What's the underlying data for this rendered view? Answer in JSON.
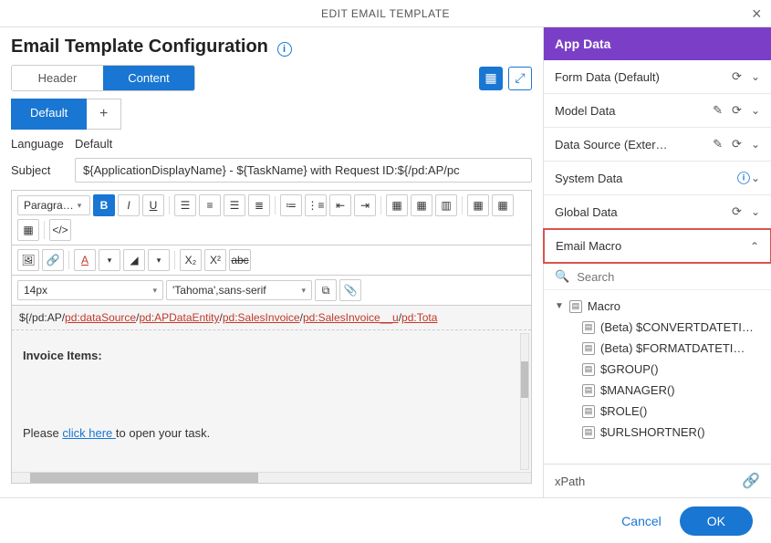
{
  "modal": {
    "title": "EDIT EMAIL TEMPLATE"
  },
  "config": {
    "title": "Email Template Configuration",
    "tabs": {
      "header": "Header",
      "content": "Content"
    },
    "subtabs": {
      "default": "Default",
      "plus": "+"
    },
    "language": {
      "label": "Language",
      "value": "Default"
    },
    "subject": {
      "label": "Subject",
      "value": "${ApplicationDisplayName} - ${TaskName} with Request ID:${/pd:AP/pc"
    }
  },
  "toolbar": {
    "paragraph": "Paragra…",
    "bold": "B",
    "italic": "I",
    "underline": "U",
    "fontsize": "14px",
    "fontfamily": "'Tahoma',sans-serif"
  },
  "editor": {
    "path_prefix": "${/pd:AP/",
    "path_segs": [
      "pd:dataSource",
      "pd:APDataEntity",
      "pd:SalesInvoice",
      "pd:SalesInvoice__u",
      "pd:Tota"
    ],
    "heading": "Invoice Items:",
    "line1a": "Please ",
    "line1_link": "click here ",
    "line1b": "to open your task."
  },
  "appdata": {
    "title": "App Data",
    "sections": {
      "form": "Form Data (Default)",
      "model": "Model Data",
      "ds": "Data Source (Exter…",
      "system": "System Data",
      "global": "Global Data",
      "macro": "Email Macro"
    },
    "search": "Search",
    "tree": {
      "root": "Macro",
      "items": [
        "(Beta) $CONVERTDATETI…",
        "(Beta) $FORMATDATETI…",
        "$GROUP()",
        "$MANAGER()",
        "$ROLE()",
        "$URLSHORTNER()"
      ],
      "more": "…"
    },
    "xpath": "xPath"
  },
  "footer": {
    "cancel": "Cancel",
    "ok": "OK"
  }
}
